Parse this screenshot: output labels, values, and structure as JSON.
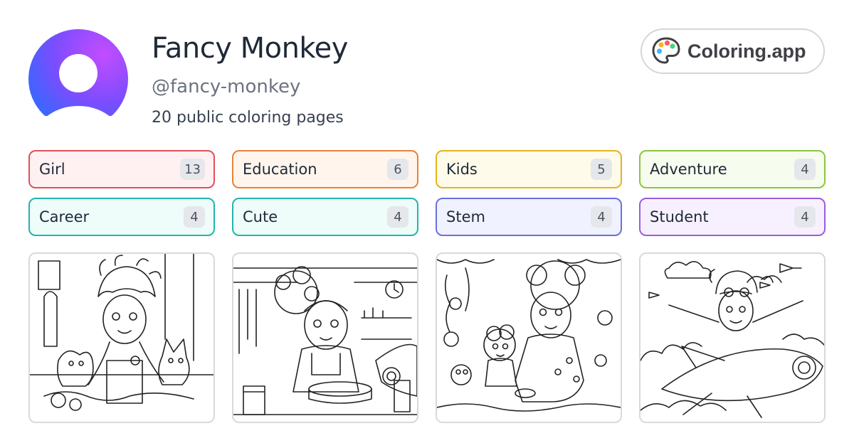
{
  "profile": {
    "name": "Fancy Monkey",
    "handle": "@fancy-monkey",
    "page_count_text": "20 public coloring pages"
  },
  "brand": {
    "label": "Coloring.app",
    "icon": "palette-icon"
  },
  "tags": [
    {
      "label": "Girl",
      "count": "13",
      "border": "#e04f5a",
      "bg": "#fff1f2"
    },
    {
      "label": "Education",
      "count": "6",
      "border": "#e9823a",
      "bg": "#fff5ec"
    },
    {
      "label": "Kids",
      "count": "5",
      "border": "#e7b21c",
      "bg": "#fffbea"
    },
    {
      "label": "Adventure",
      "count": "4",
      "border": "#8cc63f",
      "bg": "#f6fcee"
    },
    {
      "label": "Career",
      "count": "4",
      "border": "#22b5ad",
      "bg": "#eefcfa"
    },
    {
      "label": "Cute",
      "count": "4",
      "border": "#22b5ad",
      "bg": "#eefcfa"
    },
    {
      "label": "Stem",
      "count": "4",
      "border": "#6b6fe0",
      "bg": "#f1f2ff"
    },
    {
      "label": "Student",
      "count": "4",
      "border": "#9a5ce0",
      "bg": "#f7f1ff"
    }
  ],
  "thumbnails": [
    {
      "subject": "girl-with-dogs-coloring-page"
    },
    {
      "subject": "girl-in-workshop-coloring-page"
    },
    {
      "subject": "mother-and-child-garden-coloring-page"
    },
    {
      "subject": "girl-flying-plane-coloring-page"
    }
  ]
}
